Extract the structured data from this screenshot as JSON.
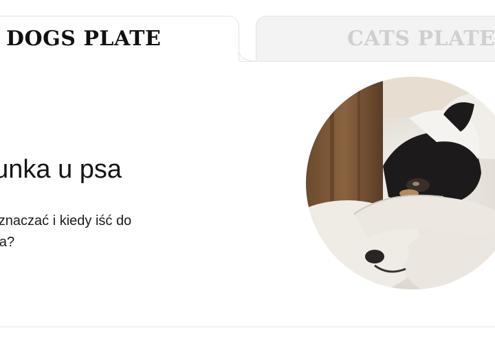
{
  "tabs": {
    "dogs_label": "DOGS PLATE",
    "cats_label": "CATS PLATE"
  },
  "article": {
    "title": "gunka u psa",
    "subtitle_line1": "że oznaczać i kiedy iść do",
    "subtitle_line2": "narza?"
  },
  "colors": {
    "active_tab_text": "#111111",
    "inactive_tab_text": "#cfcfcf",
    "inactive_tab_bg": "#f3f3f3",
    "border": "#e3e3e3"
  },
  "image": {
    "subject": "dog-covering-eyes-with-paw-on-fluffy-blanket"
  }
}
